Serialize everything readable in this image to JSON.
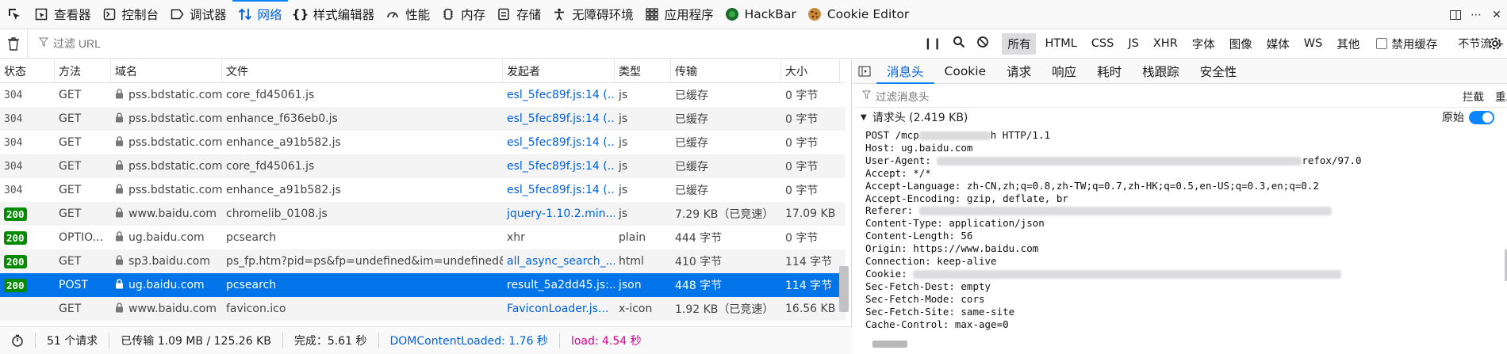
{
  "toolbar": {
    "tabs": [
      {
        "label": "查看器",
        "icon": "inspector-icon"
      },
      {
        "label": "控制台",
        "icon": "console-icon"
      },
      {
        "label": "调试器",
        "icon": "debugger-icon"
      },
      {
        "label": "网络",
        "icon": "network-icon",
        "active": true
      },
      {
        "label": "样式编辑器",
        "icon": "style-editor-icon"
      },
      {
        "label": "性能",
        "icon": "performance-icon"
      },
      {
        "label": "内存",
        "icon": "memory-icon"
      },
      {
        "label": "存储",
        "icon": "storage-icon"
      },
      {
        "label": "无障碍环境",
        "icon": "accessibility-icon"
      },
      {
        "label": "应用程序",
        "icon": "application-icon"
      },
      {
        "label": "HackBar",
        "icon": "hackbar-icon"
      },
      {
        "label": "Cookie Editor",
        "icon": "cookie-icon"
      }
    ]
  },
  "filterbar": {
    "url_placeholder": "过滤 URL",
    "types": [
      "所有",
      "HTML",
      "CSS",
      "JS",
      "XHR",
      "字体",
      "图像",
      "媒体",
      "WS",
      "其他"
    ],
    "active_type": "所有",
    "disable_cache_label": "禁用缓存",
    "throttle_label": "不节流 ÷"
  },
  "table": {
    "headers": [
      "状态",
      "方法",
      "域名",
      "文件",
      "发起者",
      "类型",
      "传输",
      "大小"
    ],
    "rows": [
      {
        "status": "304",
        "method": "GET",
        "domain": "pss.bdstatic.com",
        "file": "core_fd45061.js",
        "initiator": "esl_5fec89f.js:14 (...",
        "type": "js",
        "transfer": "已缓存",
        "size": "0 字节"
      },
      {
        "status": "304",
        "method": "GET",
        "domain": "pss.bdstatic.com",
        "file": "enhance_f636eb0.js",
        "initiator": "esl_5fec89f.js:14 (...",
        "type": "js",
        "transfer": "已缓存",
        "size": "0 字节"
      },
      {
        "status": "304",
        "method": "GET",
        "domain": "pss.bdstatic.com",
        "file": "enhance_a91b582.js",
        "initiator": "esl_5fec89f.js:14 (...",
        "type": "js",
        "transfer": "已缓存",
        "size": "0 字节"
      },
      {
        "status": "304",
        "method": "GET",
        "domain": "pss.bdstatic.com",
        "file": "core_fd45061.js",
        "initiator": "esl_5fec89f.js:14 (...",
        "type": "js",
        "transfer": "已缓存",
        "size": "0 字节"
      },
      {
        "status": "304",
        "method": "GET",
        "domain": "pss.bdstatic.com",
        "file": "enhance_a91b582.js",
        "initiator": "esl_5fec89f.js:14 (...",
        "type": "js",
        "transfer": "已缓存",
        "size": "0 字节"
      },
      {
        "status": "200",
        "method": "GET",
        "domain": "www.baidu.com",
        "file": "chromelib_0108.js",
        "initiator": "jquery-1.10.2.min....",
        "type": "js",
        "transfer": "7.29 KB（已竞速）",
        "size": "17.09 KB"
      },
      {
        "status": "200",
        "method": "OPTIO...",
        "domain": "ug.baidu.com",
        "file": "pcsearch",
        "initiator": "xhr",
        "type": "plain",
        "transfer": "444 字节",
        "size": "0 字节"
      },
      {
        "status": "200",
        "method": "GET",
        "domain": "sp3.baidu.com",
        "file": "ps_fp.htm?pid=ps&fp=undefined&im=undefined&w",
        "initiator": "all_async_search_...",
        "type": "html",
        "transfer": "410 字节",
        "size": "114 字节"
      },
      {
        "status": "200",
        "method": "POST",
        "domain": "ug.baidu.com",
        "file": "pcsearch",
        "initiator": "result_5a2dd45.js:...",
        "type": "json",
        "transfer": "448 字节",
        "size": "114 字节",
        "selected": true
      },
      {
        "status": "",
        "method": "GET",
        "domain": "www.baidu.com",
        "file": "favicon.ico",
        "initiator": "FaviconLoader.js...",
        "type": "x-icon",
        "transfer": "1.92 KB（已竞速）",
        "size": "16.56 KB"
      }
    ]
  },
  "statusbar": {
    "requests": "51 个请求",
    "transferred": "已传输 1.09 MB / 125.26 KB",
    "finish": "完成：5.61 秒",
    "dom_loaded": "DOMContentLoaded: 1.76 秒",
    "load": "load: 4.54 秒"
  },
  "details": {
    "tabs": [
      "消息头",
      "Cookie",
      "请求",
      "响应",
      "耗时",
      "栈跟踪",
      "安全性"
    ],
    "active_tab": "消息头",
    "filter_placeholder": "过滤消息头",
    "block_label": "拦截",
    "resend_label": "重发",
    "section_title": "请求头 (2.419 KB)",
    "raw_label": "原始",
    "raw_lines": [
      {
        "pre": "POST /mcp",
        "blur": 90,
        "post": "h HTTP/1.1"
      },
      {
        "pre": "Host: ug.baidu.com"
      },
      {
        "pre": "User-Agent: ",
        "blur": 460,
        "post": "refox/97.0"
      },
      {
        "pre": "Accept: */*"
      },
      {
        "pre": "Accept-Language: zh-CN,zh;q=0.8,zh-TW;q=0.7,zh-HK;q=0.5,en-US;q=0.3,en;q=0.2"
      },
      {
        "pre": "Accept-Encoding: gzip, deflate, br"
      },
      {
        "pre": "Referer: ",
        "blur": 520
      },
      {
        "pre": "Content-Type: application/json"
      },
      {
        "pre": "Content-Length: 56"
      },
      {
        "pre": "Origin: https://www.baidu.com"
      },
      {
        "pre": "Connection: keep-alive"
      },
      {
        "pre": "Cookie: ",
        "blur": 540
      },
      {
        "pre": "Sec-Fetch-Dest: empty"
      },
      {
        "pre": "Sec-Fetch-Mode: cors"
      },
      {
        "pre": "Sec-Fetch-Site: same-site"
      },
      {
        "pre": "Cache-Control: max-age=0"
      }
    ]
  },
  "colors": {
    "accent": "#0074e8",
    "status_ok": "#058b00",
    "load": "#d4018f"
  }
}
